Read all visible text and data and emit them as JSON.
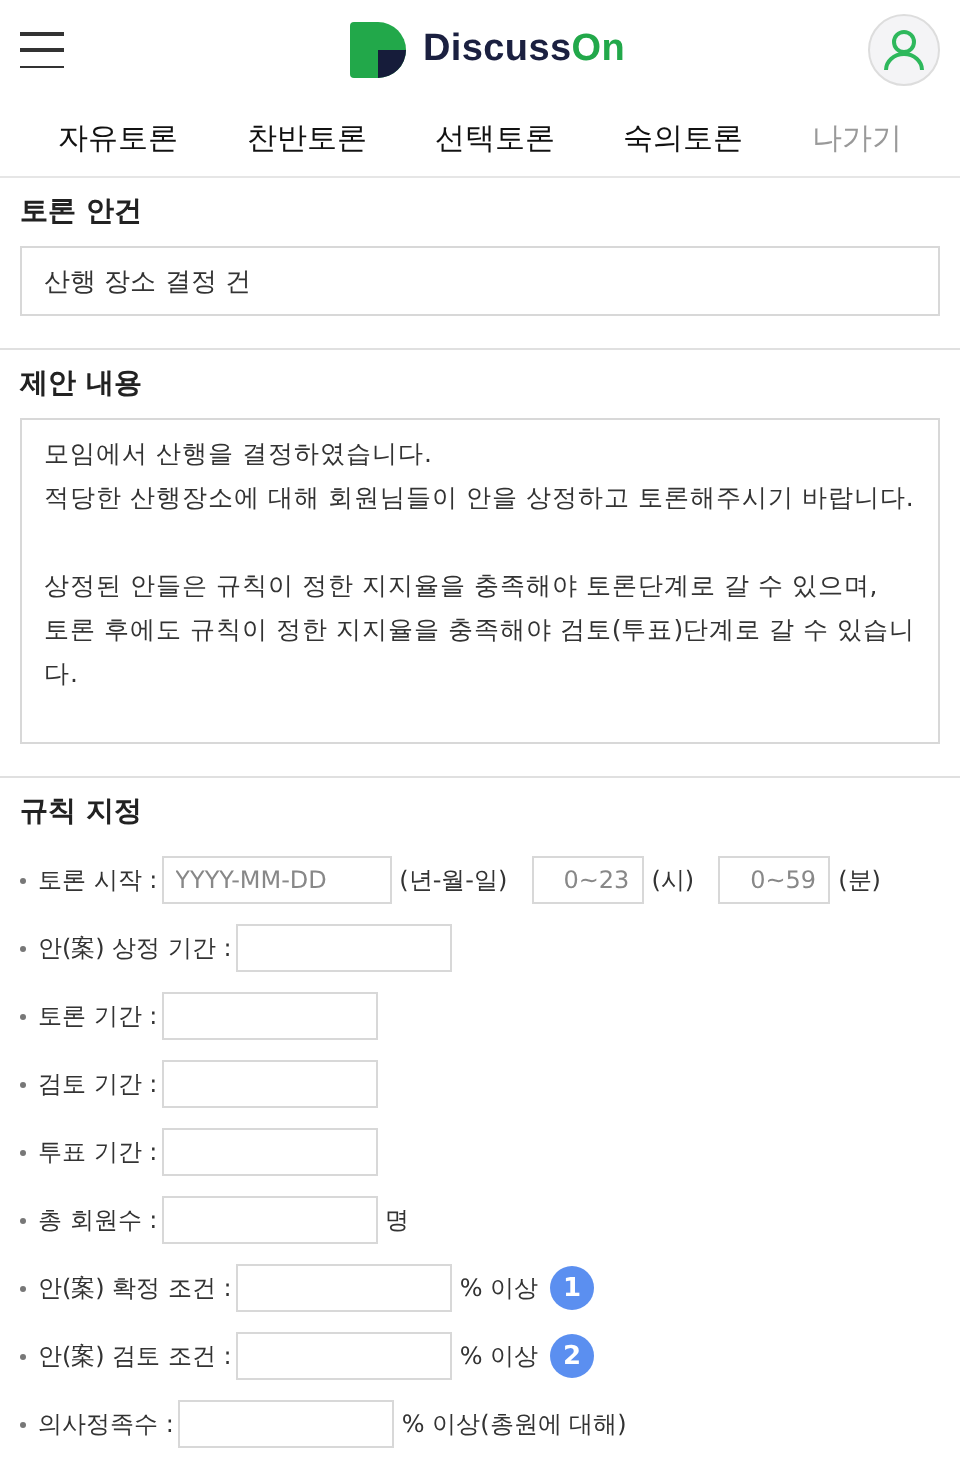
{
  "header": {
    "logo_text_dark": "Discuss",
    "logo_text_accent": "On"
  },
  "tabs": [
    {
      "label": "자유토론",
      "disabled": false
    },
    {
      "label": "찬반토론",
      "disabled": false
    },
    {
      "label": "선택토론",
      "disabled": false
    },
    {
      "label": "숙의토론",
      "disabled": false
    },
    {
      "label": "나가기",
      "disabled": true
    }
  ],
  "topic": {
    "heading": "토론 안건",
    "value": "산행 장소 결정 건"
  },
  "proposal": {
    "heading": "제안 내용",
    "value": "모임에서 산행을 결정하였습니다.\n적당한 산행장소에 대해 회원님들이 안을 상정하고 토론해주시기 바랍니다.\n\n상정된 안들은 규칙이 정한 지지율을 충족해야 토론단계로 갈 수 있으며,\n토론 후에도 규칙이 정한 지지율을 충족해야 검토(투표)단계로 갈 수 있습니다."
  },
  "rules": {
    "heading": "규칙 지정",
    "rows": [
      {
        "label": "토론 시작 :",
        "parts": [
          {
            "kind": "date",
            "placeholder": "YYYY-MM-DD"
          },
          {
            "kind": "text",
            "text": "(년-월-일)"
          },
          {
            "kind": "time",
            "placeholder": "0~23"
          },
          {
            "kind": "text",
            "text": "(시)"
          },
          {
            "kind": "time",
            "placeholder": "0~59"
          },
          {
            "kind": "text",
            "text": "(분)"
          }
        ]
      },
      {
        "label": "안(案) 상정 기간 :",
        "parts": [
          {
            "kind": "field"
          }
        ]
      },
      {
        "label": "토론 기간 :",
        "parts": [
          {
            "kind": "field"
          }
        ]
      },
      {
        "label": "검토 기간 :",
        "parts": [
          {
            "kind": "field"
          }
        ]
      },
      {
        "label": "투표 기간 :",
        "parts": [
          {
            "kind": "field"
          }
        ]
      },
      {
        "label": "총 회원수 :",
        "parts": [
          {
            "kind": "field"
          },
          {
            "kind": "text",
            "text": "명"
          }
        ]
      },
      {
        "label": "안(案) 확정 조건 :",
        "parts": [
          {
            "kind": "field"
          },
          {
            "kind": "text",
            "text": "% 이상"
          },
          {
            "kind": "badge",
            "text": "1"
          }
        ]
      },
      {
        "label": "안(案) 검토 조건 :",
        "parts": [
          {
            "kind": "field"
          },
          {
            "kind": "text",
            "text": "% 이상"
          },
          {
            "kind": "badge",
            "text": "2"
          }
        ]
      },
      {
        "label": "의사정족수 :",
        "parts": [
          {
            "kind": "field"
          },
          {
            "kind": "text",
            "text": "% 이상(총원에 대해)"
          }
        ]
      }
    ]
  }
}
